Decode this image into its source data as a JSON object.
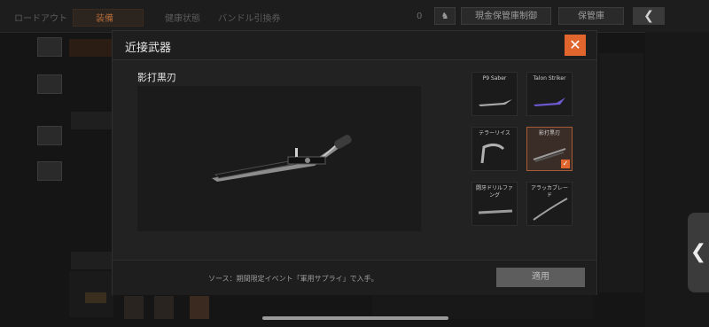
{
  "topbar": {
    "tabs": [
      "ロードアウト",
      "装備",
      "健康状態",
      "バンドル引換券"
    ],
    "count": "0",
    "cash_stash_button": "現金保管庫制御",
    "stash_button": "保管庫"
  },
  "modal": {
    "title": "近接武器",
    "close_icon": "close-x-icon",
    "selected_name": "影打黒刃",
    "weapons": [
      {
        "label": "P9 Saber",
        "selected": false
      },
      {
        "label": "Talon Striker",
        "selected": false
      },
      {
        "label": "テラーリイス",
        "selected": false
      },
      {
        "label": "影打黒刃",
        "selected": true
      },
      {
        "label": "闘牙ドリルファング",
        "selected": false
      },
      {
        "label": "アラッカブレード",
        "selected": false
      }
    ],
    "source_text": "ソース：期間限定イベント「軍用サプライ」で入手。",
    "apply_button": "適用"
  },
  "colors": {
    "accent": "#e0662e",
    "panel": "#222222",
    "background": "#161616"
  }
}
